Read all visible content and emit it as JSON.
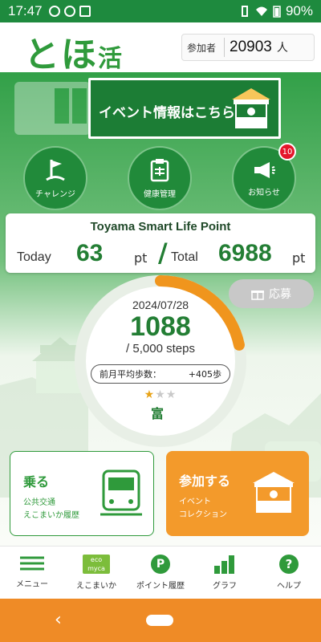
{
  "status_bar": {
    "time": "17:47",
    "battery": "90%"
  },
  "header": {
    "logo_main": "とほ",
    "logo_small": "活",
    "participants_label": "参加者",
    "participants_count": "20903",
    "participants_unit": "人"
  },
  "banner": {
    "text": "イベント情報はこちら"
  },
  "quick_buttons": [
    {
      "label": "チャレンジ"
    },
    {
      "label": "健康管理"
    },
    {
      "label": "お知らせ",
      "badge": "10"
    }
  ],
  "points": {
    "title": "Toyama Smart Life Point",
    "today_label": "Today",
    "today_value": "63",
    "unit": "pt",
    "separator": "/",
    "total_label": "Total",
    "total_value": "6988"
  },
  "apply_button": {
    "label": "応募"
  },
  "steps": {
    "date": "2024/07/28",
    "count": "1088",
    "goal": "/ 5,000 steps",
    "avg_label": "前月平均歩数：",
    "avg_value": "+405歩",
    "stars_filled": 1,
    "stars_total": 3,
    "progress": 0.2176,
    "rank_glyph": "富"
  },
  "cards": {
    "ride": {
      "title": "乗る",
      "line1": "公共交通",
      "line2": "えこまいか履歴"
    },
    "join": {
      "title": "参加する",
      "line1": "イベント",
      "line2": "コレクション"
    }
  },
  "bottom_nav": [
    {
      "label": "メニュー"
    },
    {
      "label": "えこまいか",
      "icon_text_1": "eco",
      "icon_text_2": "myca"
    },
    {
      "label": "ポイント履歴",
      "icon_text": "P"
    },
    {
      "label": "グラフ"
    },
    {
      "label": "ヘルプ",
      "icon_text": "?"
    }
  ],
  "colors": {
    "primary": "#2f9a3b",
    "dark_green": "#218a3a",
    "accent_orange": "#f39a2b",
    "badge_red": "#e4162b"
  }
}
